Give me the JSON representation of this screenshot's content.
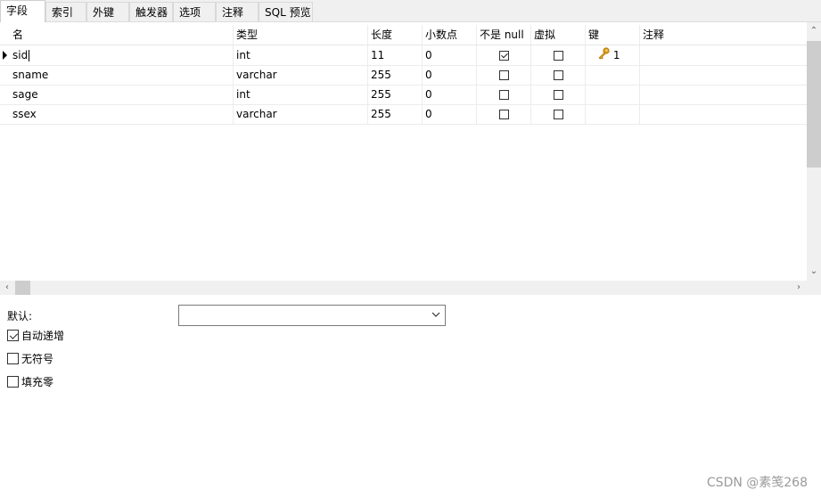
{
  "tabs": [
    "字段",
    "索引",
    "外键",
    "触发器",
    "选项",
    "注释",
    "SQL 预览"
  ],
  "columns": {
    "name": "名",
    "type": "类型",
    "length": "长度",
    "decimals": "小数点",
    "not_null": "不是 null",
    "virtual": "虚拟",
    "key": "键",
    "comment": "注释"
  },
  "rows": [
    {
      "name": "sid",
      "type": "int",
      "length": "11",
      "decimals": "0",
      "not_null": true,
      "virtual": false,
      "key": "1",
      "key_icon": "key-icon"
    },
    {
      "name": "sname",
      "type": "varchar",
      "length": "255",
      "decimals": "0",
      "not_null": false,
      "virtual": false,
      "key": ""
    },
    {
      "name": "sage",
      "type": "int",
      "length": "255",
      "decimals": "0",
      "not_null": false,
      "virtual": false,
      "key": ""
    },
    {
      "name": "ssex",
      "type": "varchar",
      "length": "255",
      "decimals": "0",
      "not_null": false,
      "virtual": false,
      "key": ""
    }
  ],
  "panel": {
    "default_label": "默认:",
    "default_value": "",
    "auto_increment": {
      "label": "自动递增",
      "checked": true
    },
    "unsigned": {
      "label": "无符号",
      "checked": false
    },
    "zerofill": {
      "label": "填充零",
      "checked": false
    }
  },
  "watermark": "CSDN @素笺268",
  "colors": {
    "key_gold": "#e0a020",
    "tab_bg": "#f0f0f0",
    "scroll_thumb": "#cdcdcd"
  }
}
